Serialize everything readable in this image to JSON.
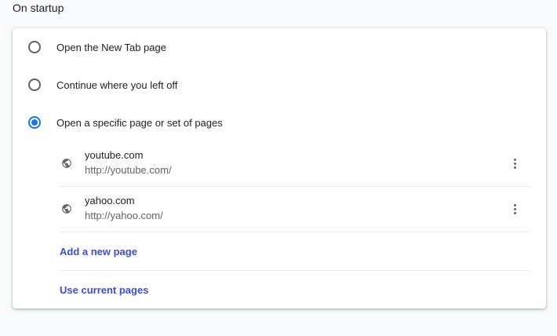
{
  "section": {
    "title": "On startup"
  },
  "options": [
    {
      "label": "Open the New Tab page",
      "checked": false
    },
    {
      "label": "Continue where you left off",
      "checked": false
    },
    {
      "label": "Open a specific page or set of pages",
      "checked": true
    }
  ],
  "pages": [
    {
      "name": "youtube.com",
      "url": "http://youtube.com/",
      "icon": "globe-icon"
    },
    {
      "name": "yahoo.com",
      "url": "http://yahoo.com/",
      "icon": "globe-icon"
    }
  ],
  "actions": {
    "add_page": "Add a new page",
    "use_current": "Use current pages"
  },
  "colors": {
    "accent": "#1a73e8",
    "link": "#3c4ec8",
    "secondary_text": "#5f6368"
  }
}
